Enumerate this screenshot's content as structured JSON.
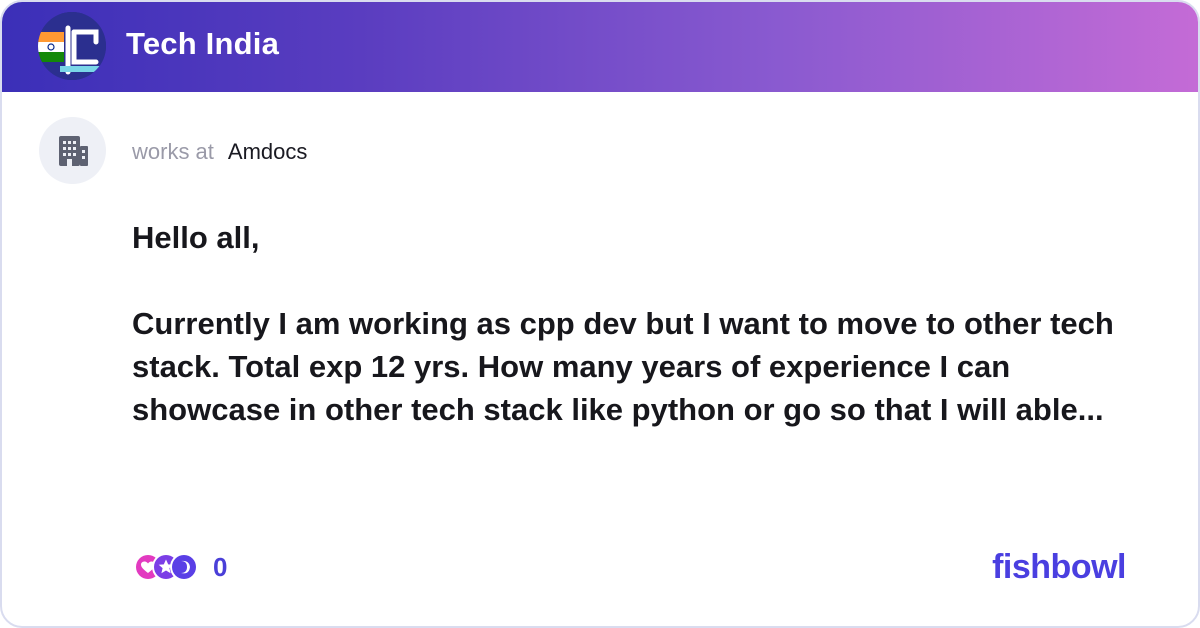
{
  "community": {
    "title": "Tech India",
    "logo_icon": "india-flag-code-bowl-icon"
  },
  "author": {
    "avatar_icon": "office-building-icon",
    "works_at_label": "works at",
    "company": "Amdocs"
  },
  "post": {
    "greeting": "Hello all,",
    "text": "Currently I am working as cpp dev but I want to move to other tech stack. Total exp 12 yrs. How many years of experience  I can showcase in other tech stack like python or go so that I will able..."
  },
  "reactions": {
    "icons": [
      "heart-reaction-icon",
      "star-reaction-icon",
      "clap-reaction-icon"
    ],
    "count": "0"
  },
  "brand": {
    "name": "fishbowl",
    "color": "#4a3fe0"
  },
  "colors": {
    "header_gradient_start": "#3b2fb8",
    "header_gradient_end": "#c46bd6",
    "accent": "#4a3fd8"
  }
}
